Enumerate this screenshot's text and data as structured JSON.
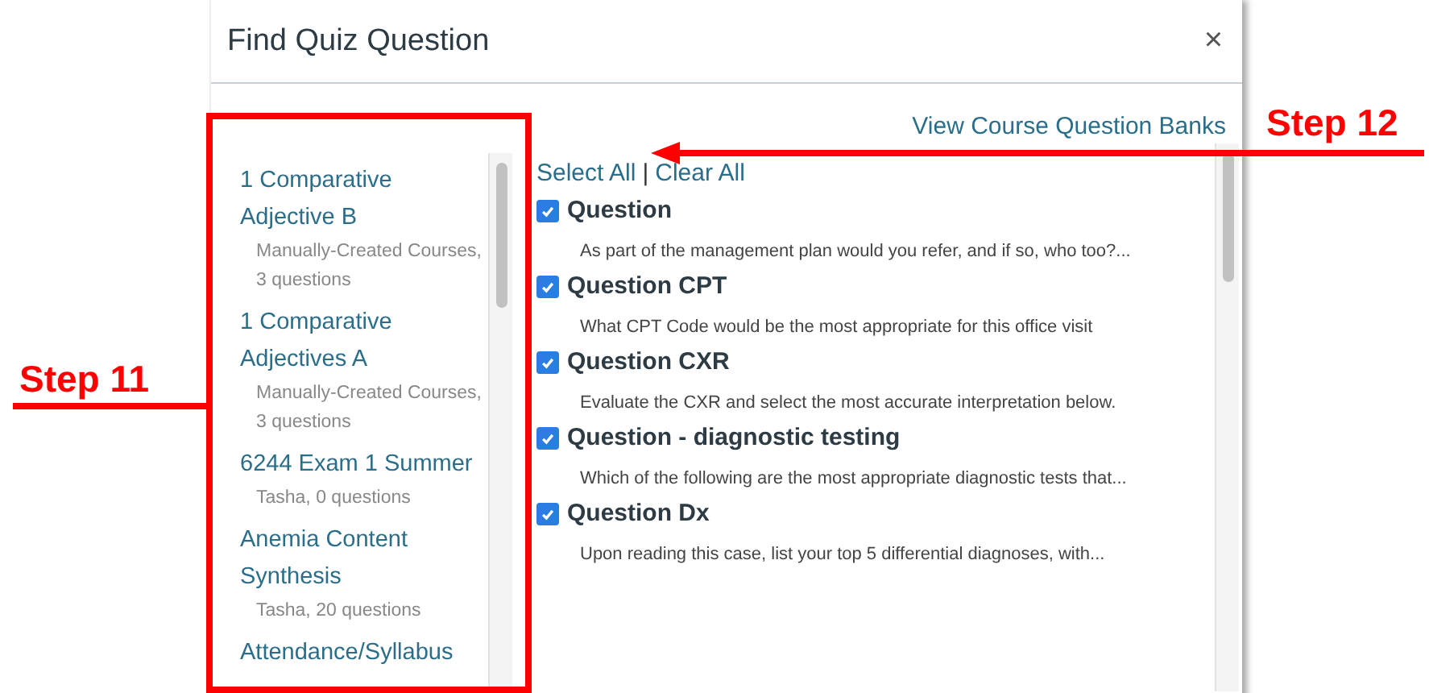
{
  "dialog": {
    "title": "Find Quiz Question",
    "close": "×"
  },
  "banks_link": "View Course Question Banks",
  "banks": [
    {
      "name": "1 Comparative Adjective B",
      "meta": "Manually-Created Courses, 3 questions"
    },
    {
      "name": "1 Comparative Adjectives A",
      "meta": "Manually-Created Courses, 3 questions"
    },
    {
      "name": "6244 Exam 1 Summer",
      "meta": "Tasha, 0 questions"
    },
    {
      "name": "Anemia Content Synthesis",
      "meta": "Tasha, 20 questions"
    },
    {
      "name": "Attendance/Syllabus"
    }
  ],
  "select_all": "Select All",
  "separator": "|",
  "clear_all": "Clear All",
  "questions": [
    {
      "title": "Question",
      "text": "As part of the management plan would you refer, and if so, who too?...",
      "checked": true
    },
    {
      "title": "Question CPT",
      "text": "What CPT Code would be the most appropriate for this office visit",
      "checked": true
    },
    {
      "title": "Question CXR",
      "text": "Evaluate the CXR and select the most accurate interpretation below.",
      "checked": true
    },
    {
      "title": "Question - diagnostic testing",
      "text": "Which of the following are the most appropriate diagnostic tests that...",
      "checked": true
    },
    {
      "title": "Question Dx",
      "text": "Upon reading this case, list your top 5 differential diagnoses, with...",
      "checked": true
    }
  ],
  "annotations": [
    {
      "label": "Step 11"
    },
    {
      "label": "Step 12"
    }
  ]
}
